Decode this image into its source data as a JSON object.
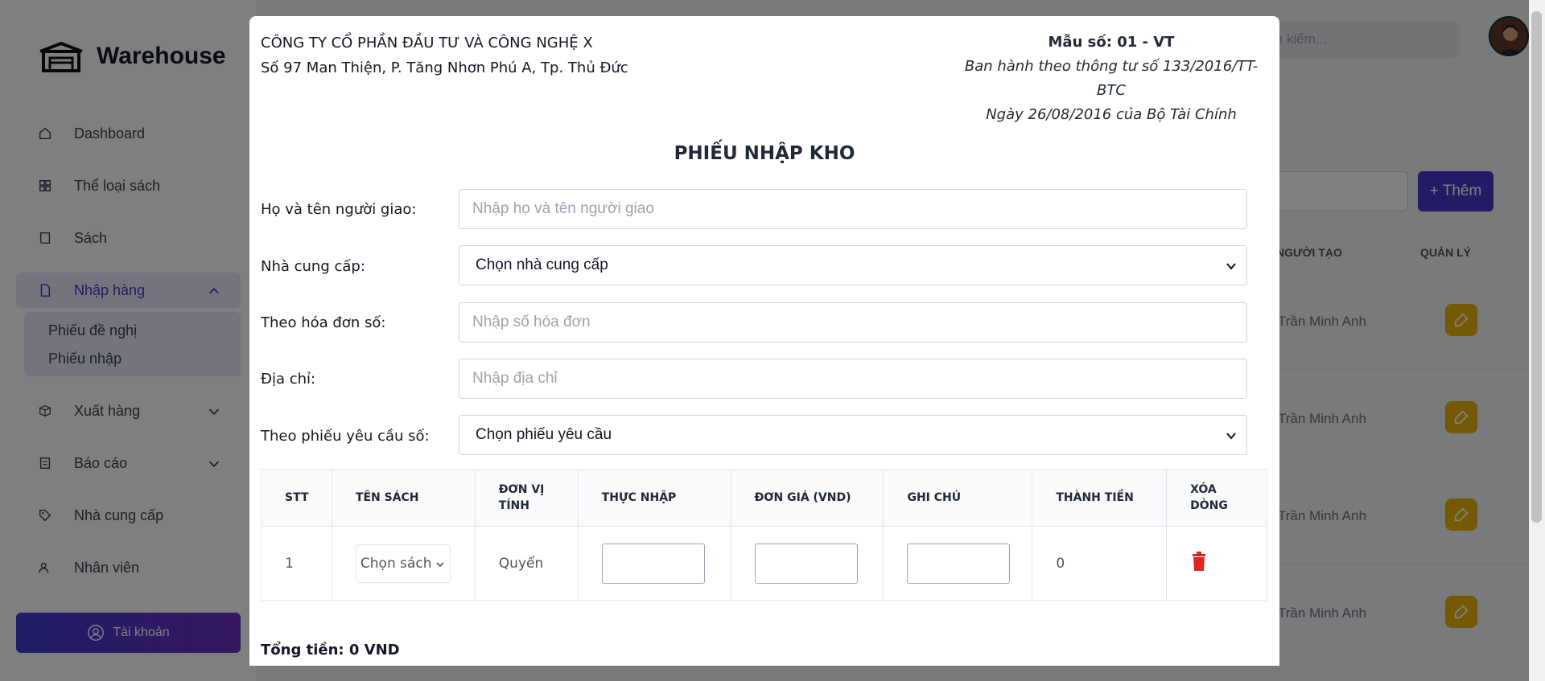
{
  "app": {
    "name": "Warehouse"
  },
  "sidebar": {
    "items": [
      {
        "label": "Dashboard",
        "icon": "home-icon"
      },
      {
        "label": "Thể loại sách",
        "icon": "grid-icon"
      },
      {
        "label": "Sách",
        "icon": "book-icon"
      },
      {
        "label": "Nhập hàng",
        "icon": "import-doc-icon",
        "active": true,
        "expanded": true
      },
      {
        "label": "Xuất hàng",
        "icon": "export-box-icon"
      },
      {
        "label": "Báo cáo",
        "icon": "report-icon"
      },
      {
        "label": "Nhà cung cấp",
        "icon": "tag-icon"
      },
      {
        "label": "Nhân viên",
        "icon": "users-icon"
      }
    ],
    "submenu": [
      "Phiếu đề nghị",
      "Phiếu nhập"
    ],
    "account_label": "Tài khoản"
  },
  "topbar": {
    "search_placeholder": "m kiếm..."
  },
  "background_page": {
    "add_label": "+ Thêm",
    "col_creator": "NGƯỜI TẠO",
    "col_manage": "QUẢN LÝ",
    "rows": [
      "Trần Minh Anh",
      "Trần Minh Anh",
      "Trần Minh Anh",
      "Trần Minh Anh"
    ]
  },
  "modal": {
    "company_name": "CÔNG TY CỔ PHẦN ĐẦU TƯ VÀ CÔNG NGHỆ X",
    "company_address": "Số 97 Man Thiện, P. Tăng Nhơn Phú A, Tp. Thủ Đức",
    "form_code": "Mẫu số: 01 - VT",
    "regulation": "Ban hành theo thông tư số 133/2016/TT-BTC",
    "regulation_date": "Ngày 26/08/2016 của Bộ Tài Chính",
    "title": "PHIẾU NHẬP KHO",
    "fields": {
      "deliverer_label": "Họ và tên người giao:",
      "deliverer_placeholder": "Nhập họ và tên người giao",
      "supplier_label": "Nhà cung cấp:",
      "supplier_value": "Chọn nhà cung cấp",
      "invoice_label": "Theo hóa đơn số:",
      "invoice_placeholder": "Nhập số hóa đơn",
      "address_label": "Địa chỉ:",
      "address_placeholder": "Nhập địa chỉ",
      "request_label": "Theo phiếu yêu cầu số:",
      "request_value": "Chọn phiếu yêu cầu"
    },
    "table": {
      "headers": [
        "STT",
        "TÊN SÁCH",
        "ĐƠN VỊ TÍNH",
        "THỰC NHẬP",
        "ĐƠN GIÁ (VND)",
        "GHI CHÚ",
        "THÀNH TIỀN",
        "XÓA DÒNG"
      ],
      "rows": [
        {
          "stt": "1",
          "book": "Chọn sách",
          "unit": "Quyển",
          "quantity": "",
          "price": "",
          "note": "",
          "amount": "0"
        }
      ]
    },
    "total": "Tổng tiền: 0 VND"
  },
  "colors": {
    "accent": "#4338ca",
    "edit": "#eab308",
    "delete": "#dc2626"
  }
}
